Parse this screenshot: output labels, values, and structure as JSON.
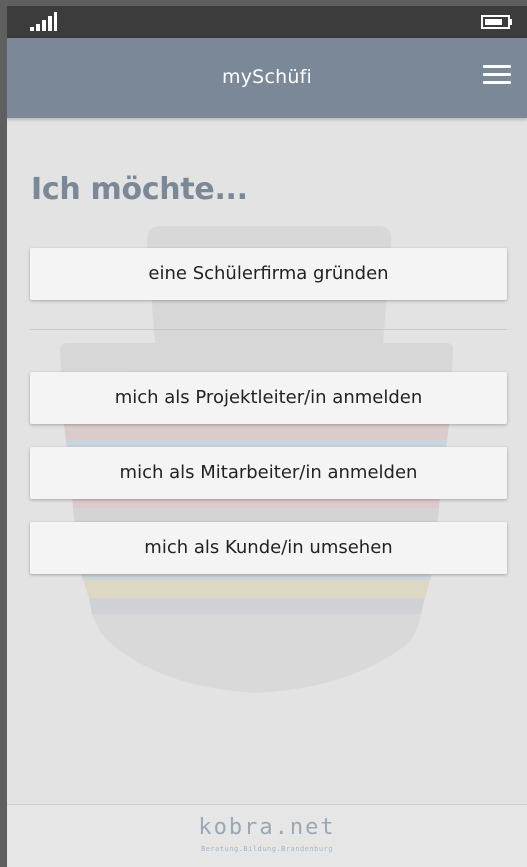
{
  "app": {
    "title": "mySchüfi"
  },
  "icons": {
    "signal": "signal-icon",
    "battery": "battery-icon",
    "menu": "hamburger-menu-icon"
  },
  "colors": {
    "status_bar": "#3c3c3c",
    "app_bar": "#7a8897",
    "heading": "#7b8898",
    "background": "#e3e3e3",
    "button": "#f4f4f4"
  },
  "main": {
    "heading": "Ich möchte...",
    "buttons": [
      {
        "label": "eine Schülerfirma gründen"
      },
      {
        "label": "mich als Projektleiter/in anmelden"
      },
      {
        "label": "mich als Mitarbeiter/in anmelden"
      },
      {
        "label": "mich als Kunde/in umsehen"
      }
    ]
  },
  "footer": {
    "logo": "kobra.net",
    "tagline": "Beratung.Bildung.Brandenburg"
  }
}
